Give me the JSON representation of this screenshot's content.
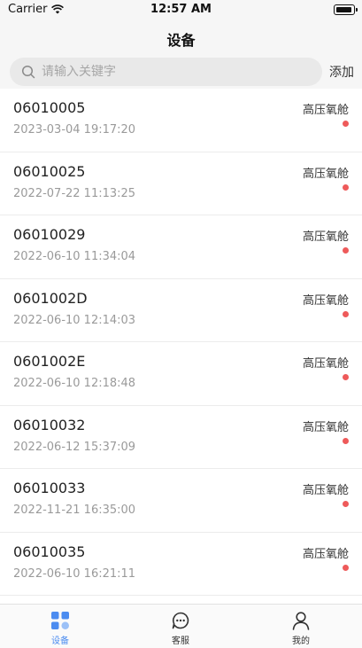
{
  "status_bar": {
    "carrier": "Carrier",
    "time": "12:57 AM"
  },
  "nav": {
    "title": "设备"
  },
  "search": {
    "placeholder": "请输入关键字",
    "value": "",
    "add_label": "添加"
  },
  "devices": [
    {
      "id": "06010005",
      "time": "2023-03-04 19:17:20",
      "type": "高压氧舱"
    },
    {
      "id": "06010025",
      "time": "2022-07-22 11:13:25",
      "type": "高压氧舱"
    },
    {
      "id": "06010029",
      "time": "2022-06-10 11:34:04",
      "type": "高压氧舱"
    },
    {
      "id": "0601002D",
      "time": "2022-06-10 12:14:03",
      "type": "高压氧舱"
    },
    {
      "id": "0601002E",
      "time": "2022-06-10 12:18:48",
      "type": "高压氧舱"
    },
    {
      "id": "06010032",
      "time": "2022-06-12 15:37:09",
      "type": "高压氧舱"
    },
    {
      "id": "06010033",
      "time": "2022-11-21 16:35:00",
      "type": "高压氧舱"
    },
    {
      "id": "06010035",
      "time": "2022-06-10 16:21:11",
      "type": "高压氧舱"
    }
  ],
  "tabs": [
    {
      "label": "设备",
      "icon": "grid-icon",
      "active": true
    },
    {
      "label": "客服",
      "icon": "chat-icon",
      "active": false
    },
    {
      "label": "我的",
      "icon": "person-icon",
      "active": false
    }
  ],
  "colors": {
    "accent": "#4b8cf0",
    "status_dot": "#ee5a5a",
    "nav_bg": "#f6f6f6"
  }
}
